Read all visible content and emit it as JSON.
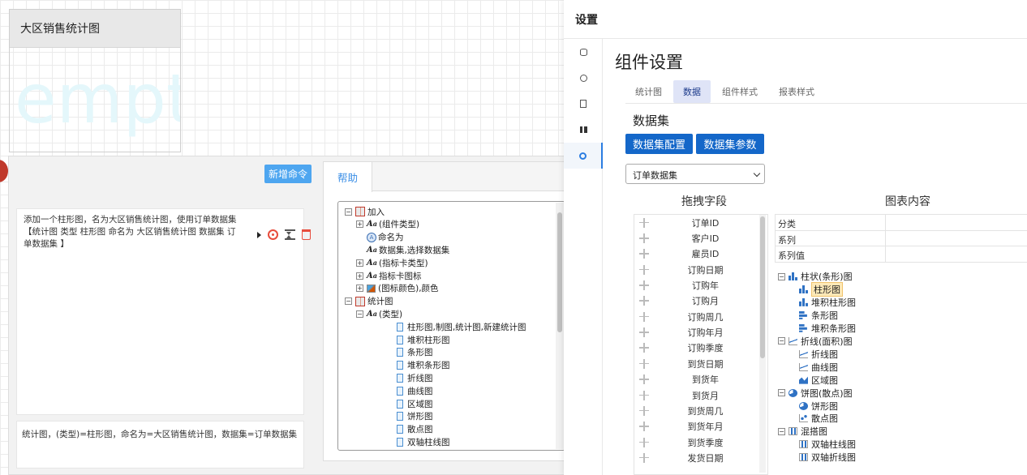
{
  "chart_widget": {
    "title": "大区销售统计图",
    "watermark": "empt"
  },
  "command_panel": {
    "new_command_label": "新增命令",
    "command_text": "添加一个柱形图，名为大区销售统计图，使用订单数据集【统计图 类型 柱形图 命名为 大区销售统计图 数据集 订单数据集 】",
    "result_text": "统计图，(类型)=柱形图，命名为=大区销售统计图，数据集=订单数据集"
  },
  "help": {
    "tab_label": "帮助",
    "tree": [
      {
        "label": "加入",
        "pm": "⊟",
        "level": 0,
        "icon": "grid"
      },
      {
        "label": "(组件类型)",
        "pm": "⊞",
        "level": 1,
        "icon": "aa"
      },
      {
        "label": "命名为",
        "pm": "",
        "level": 1,
        "icon": "circle"
      },
      {
        "label": "数据集,选择数据集",
        "pm": "",
        "level": 1,
        "icon": "aa"
      },
      {
        "label": "(指标卡类型)",
        "pm": "⊞",
        "level": 1,
        "icon": "aa"
      },
      {
        "label": "指标卡图标",
        "pm": "⊞",
        "level": 1,
        "icon": "aa"
      },
      {
        "label": "(图标颜色),颜色",
        "pm": "⊞",
        "level": 1,
        "icon": "img"
      },
      {
        "label": "统计图",
        "pm": "⊟",
        "level": 0,
        "icon": "grid"
      },
      {
        "label": "(类型)",
        "pm": "⊟",
        "level": 1,
        "icon": "aa"
      },
      {
        "label": "柱形图,制图,统计图,新建统计图",
        "pm": "",
        "level": 2,
        "icon": "doc"
      },
      {
        "label": "堆积柱形图",
        "pm": "",
        "level": 2,
        "icon": "doc"
      },
      {
        "label": "条形图",
        "pm": "",
        "level": 2,
        "icon": "doc"
      },
      {
        "label": "堆积条形图",
        "pm": "",
        "level": 2,
        "icon": "doc"
      },
      {
        "label": "折线图",
        "pm": "",
        "level": 2,
        "icon": "doc"
      },
      {
        "label": "曲线图",
        "pm": "",
        "level": 2,
        "icon": "doc"
      },
      {
        "label": "区域图",
        "pm": "",
        "level": 2,
        "icon": "doc"
      },
      {
        "label": "饼形图",
        "pm": "",
        "level": 2,
        "icon": "doc"
      },
      {
        "label": "散点图",
        "pm": "",
        "level": 2,
        "icon": "doc"
      },
      {
        "label": "双轴柱线图",
        "pm": "",
        "level": 2,
        "icon": "doc"
      }
    ]
  },
  "settings": {
    "title": "设置",
    "component_title": "组件设置",
    "tabs": [
      "统计图",
      "数据",
      "组件样式",
      "报表样式"
    ],
    "active_tab": "数据",
    "dataset_label": "数据集",
    "btn_config": "数据集配置",
    "btn_params": "数据集参数",
    "dataset_selected": "订单数据集",
    "drag_header": "拖拽字段",
    "chart_header": "图表内容",
    "fields": [
      "订单ID",
      "客户ID",
      "雇员ID",
      "订购日期",
      "订购年",
      "订购月",
      "订购周几",
      "订购年月",
      "订购季度",
      "到货日期",
      "到货年",
      "到货月",
      "到货周几",
      "到货年月",
      "到货季度",
      "发货日期"
    ],
    "chart_rows": [
      "分类",
      "系列",
      "系列值"
    ],
    "chart_tree": [
      {
        "label": "柱状(条形)图",
        "level": 0,
        "icon": "bar"
      },
      {
        "label": "柱形图",
        "level": 1,
        "icon": "bar",
        "selected": true
      },
      {
        "label": "堆积柱形图",
        "level": 1,
        "icon": "bar"
      },
      {
        "label": "条形图",
        "level": 1,
        "icon": "hbar"
      },
      {
        "label": "堆积条形图",
        "level": 1,
        "icon": "hbar"
      },
      {
        "label": "折线(面积)图",
        "level": 0,
        "icon": "line"
      },
      {
        "label": "折线图",
        "level": 1,
        "icon": "line"
      },
      {
        "label": "曲线图",
        "level": 1,
        "icon": "line"
      },
      {
        "label": "区域图",
        "level": 1,
        "icon": "area"
      },
      {
        "label": "饼图(散点)图",
        "level": 0,
        "icon": "pie"
      },
      {
        "label": "饼形图",
        "level": 1,
        "icon": "pie"
      },
      {
        "label": "散点图",
        "level": 1,
        "icon": "scatter"
      },
      {
        "label": "混搭图",
        "level": 0,
        "icon": "combo"
      },
      {
        "label": "双轴柱线图",
        "level": 1,
        "icon": "combo"
      },
      {
        "label": "双轴折线图",
        "level": 1,
        "icon": "combo"
      }
    ]
  }
}
